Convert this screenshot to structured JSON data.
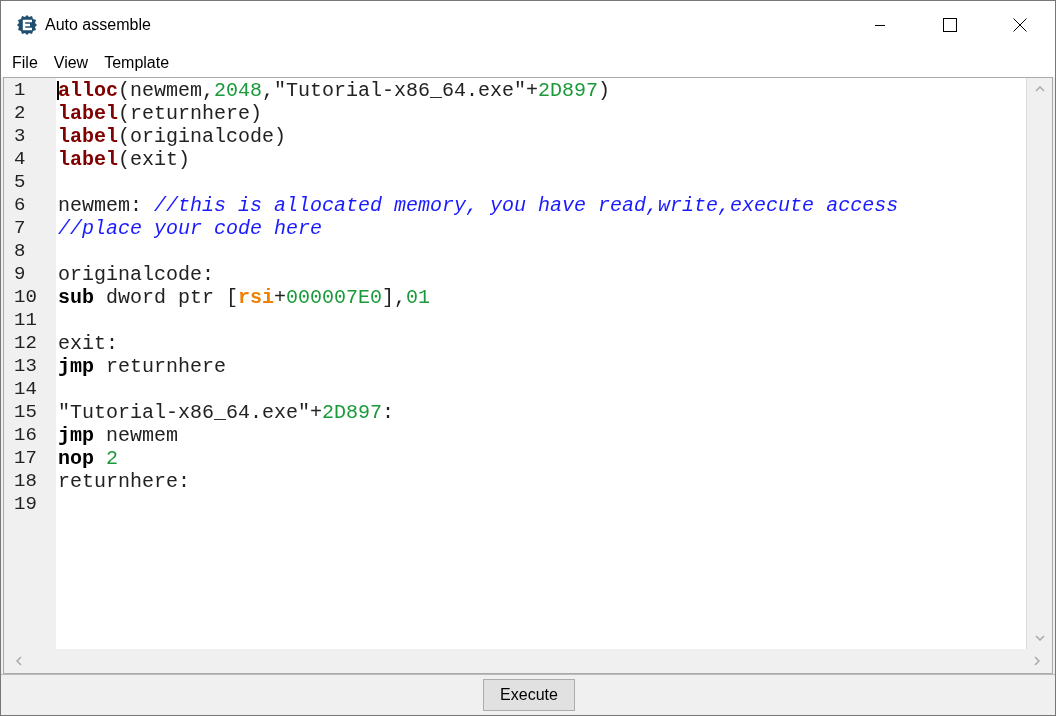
{
  "window": {
    "title": "Auto assemble"
  },
  "menu": [
    {
      "label": "File"
    },
    {
      "label": "View"
    },
    {
      "label": "Template"
    }
  ],
  "editor": {
    "lines": [
      {
        "number": "1",
        "tokens": [
          {
            "kind": "keyword",
            "text": "alloc"
          },
          {
            "kind": "plain",
            "text": "(newmem,"
          },
          {
            "kind": "number",
            "text": "2048"
          },
          {
            "kind": "plain",
            "text": ",\"Tutorial-x86_64.exe\"+"
          },
          {
            "kind": "number",
            "text": "2D897"
          },
          {
            "kind": "plain",
            "text": ")"
          }
        ]
      },
      {
        "number": "2",
        "tokens": [
          {
            "kind": "keyword",
            "text": "label"
          },
          {
            "kind": "plain",
            "text": "(returnhere)"
          }
        ]
      },
      {
        "number": "3",
        "tokens": [
          {
            "kind": "keyword",
            "text": "label"
          },
          {
            "kind": "plain",
            "text": "(originalcode)"
          }
        ]
      },
      {
        "number": "4",
        "tokens": [
          {
            "kind": "keyword",
            "text": "label"
          },
          {
            "kind": "plain",
            "text": "(exit)"
          }
        ]
      },
      {
        "number": "5"
      },
      {
        "number": "6",
        "tokens": [
          {
            "kind": "plain",
            "text": "newmem: "
          },
          {
            "kind": "comment",
            "text": "//this is allocated memory, you have read,write,execute access"
          }
        ]
      },
      {
        "number": "7",
        "tokens": [
          {
            "kind": "comment",
            "text": "//place your code here"
          }
        ]
      },
      {
        "number": "8"
      },
      {
        "number": "9",
        "tokens": [
          {
            "kind": "plain",
            "text": "originalcode:"
          }
        ]
      },
      {
        "number": "10",
        "tokens": [
          {
            "kind": "instruction",
            "text": "sub"
          },
          {
            "kind": "plain",
            "text": " dword ptr ["
          },
          {
            "kind": "register",
            "text": "rsi"
          },
          {
            "kind": "plain",
            "text": "+"
          },
          {
            "kind": "number",
            "text": "000007E0"
          },
          {
            "kind": "plain",
            "text": "],"
          },
          {
            "kind": "number",
            "text": "01"
          }
        ]
      },
      {
        "number": "11"
      },
      {
        "number": "12",
        "tokens": [
          {
            "kind": "plain",
            "text": "exit:"
          }
        ]
      },
      {
        "number": "13",
        "tokens": [
          {
            "kind": "instruction",
            "text": "jmp"
          },
          {
            "kind": "plain",
            "text": " returnhere"
          }
        ]
      },
      {
        "number": "14"
      },
      {
        "number": "15",
        "tokens": [
          {
            "kind": "plain",
            "text": "\"Tutorial-x86_64.exe\"+"
          },
          {
            "kind": "number",
            "text": "2D897"
          },
          {
            "kind": "plain",
            "text": ":"
          }
        ]
      },
      {
        "number": "16",
        "tokens": [
          {
            "kind": "instruction",
            "text": "jmp"
          },
          {
            "kind": "plain",
            "text": " newmem"
          }
        ]
      },
      {
        "number": "17",
        "tokens": [
          {
            "kind": "instruction",
            "text": "nop "
          },
          {
            "kind": "number",
            "text": "2"
          }
        ]
      },
      {
        "number": "18",
        "tokens": [
          {
            "kind": "plain",
            "text": "returnhere:"
          }
        ]
      },
      {
        "number": "19"
      }
    ]
  },
  "buttons": [
    {
      "label": "Execute"
    }
  ]
}
